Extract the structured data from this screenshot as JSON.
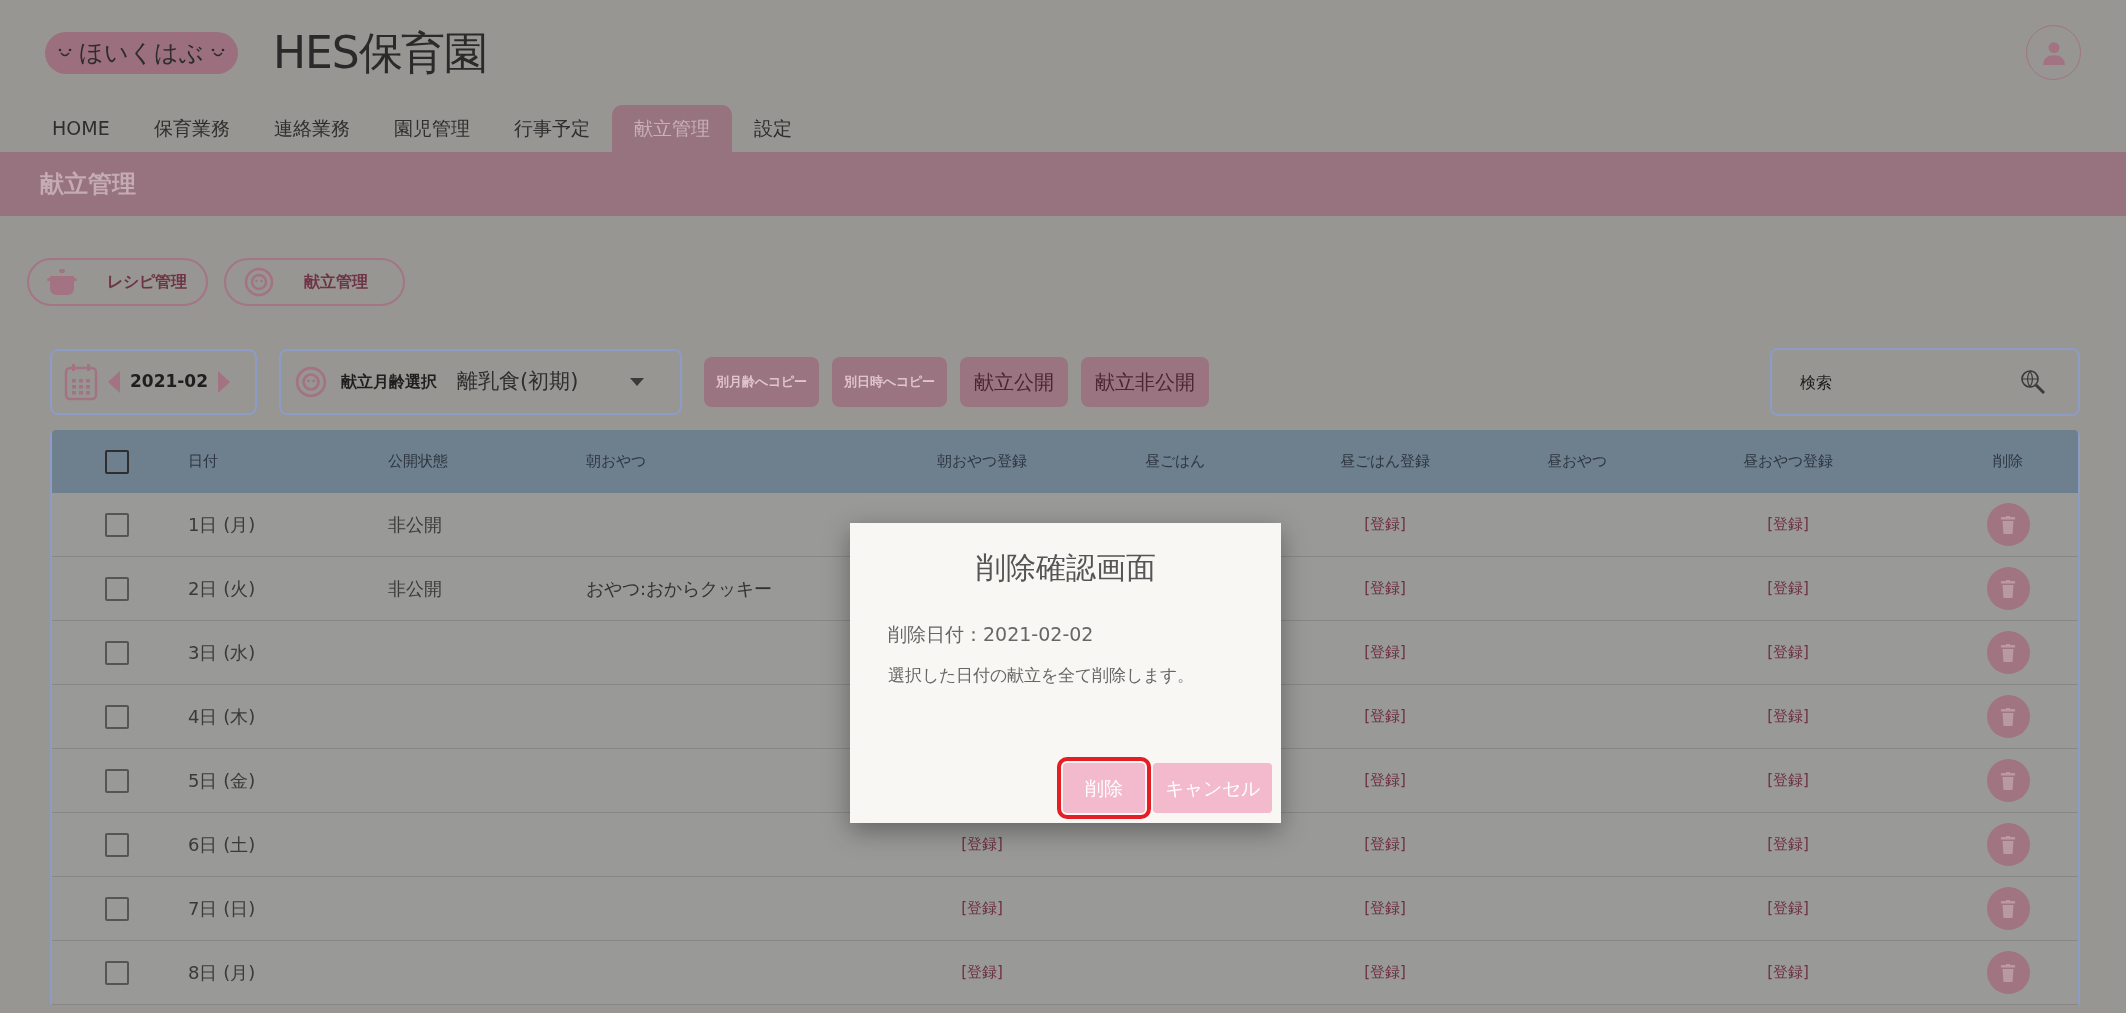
{
  "header": {
    "logo": "ほいくはぶ",
    "title": "HES保育園"
  },
  "nav": [
    {
      "label": "HOME",
      "selected": false
    },
    {
      "label": "保育業務",
      "selected": false
    },
    {
      "label": "連絡業務",
      "selected": false
    },
    {
      "label": "園児管理",
      "selected": false
    },
    {
      "label": "行事予定",
      "selected": false
    },
    {
      "label": "献立管理",
      "selected": true
    },
    {
      "label": "設定",
      "selected": false
    }
  ],
  "page_title": "献立管理",
  "sub_buttons": [
    {
      "label": "レシピ管理",
      "kind": "pot"
    },
    {
      "label": "献立管理",
      "kind": "face"
    }
  ],
  "toolbar": {
    "month": "2021-02",
    "age_select": {
      "label": "献立月齢選択",
      "value": "離乳食(初期)"
    },
    "actions": [
      {
        "label": "別月齢へコピー",
        "kind": "copy"
      },
      {
        "label": "別日時へコピー",
        "kind": "copy"
      },
      {
        "label": "献立公開",
        "kind": "publish"
      },
      {
        "label": "献立非公開",
        "kind": "publish"
      }
    ],
    "search": {
      "placeholder": "検索"
    }
  },
  "table": {
    "all_checked": false,
    "columns": [
      "日付",
      "公開状態",
      "朝おやつ",
      "朝おやつ登録",
      "昼ごはん",
      "昼ごはん登録",
      "昼おやつ",
      "昼おやつ登録",
      "削除"
    ],
    "rows": [
      {
        "checked": false,
        "date": "1日 (月)",
        "status": "非公開",
        "lunch_register": "[登録]",
        "afternoon_snack_register": "[登録]"
      },
      {
        "checked": false,
        "date": "2日 (火)",
        "status": "非公開",
        "morning_snack": "おやつ:おからクッキー",
        "lunch_register": "[登録]",
        "afternoon_snack_register": "[登録]"
      },
      {
        "checked": false,
        "date": "3日 (水)",
        "lunch_register": "[登録]",
        "afternoon_snack_register": "[登録]"
      },
      {
        "checked": false,
        "date": "4日 (木)",
        "lunch_register": "[登録]",
        "afternoon_snack_register": "[登録]"
      },
      {
        "checked": false,
        "date": "5日 (金)",
        "lunch_register": "[登録]",
        "afternoon_snack_register": "[登録]"
      },
      {
        "checked": false,
        "date": "6日 (土)",
        "morning_snack_register": "[登録]",
        "lunch_register": "[登録]",
        "afternoon_snack_register": "[登録]"
      },
      {
        "checked": false,
        "date": "7日 (日)",
        "morning_snack_register": "[登録]",
        "lunch_register": "[登録]",
        "afternoon_snack_register": "[登録]"
      },
      {
        "checked": false,
        "date": "8日 (月)",
        "morning_snack_register": "[登録]",
        "lunch_register": "[登録]",
        "afternoon_snack_register": "[登録]"
      }
    ]
  },
  "dialog": {
    "title": "削除確認画面",
    "date_line": "削除日付：2021-02-02",
    "message": "選択した日付の献立を全て削除します。",
    "buttons": [
      {
        "label": "削除",
        "highlighted": true
      },
      {
        "label": "キャンセル",
        "highlighted": false
      }
    ]
  }
}
